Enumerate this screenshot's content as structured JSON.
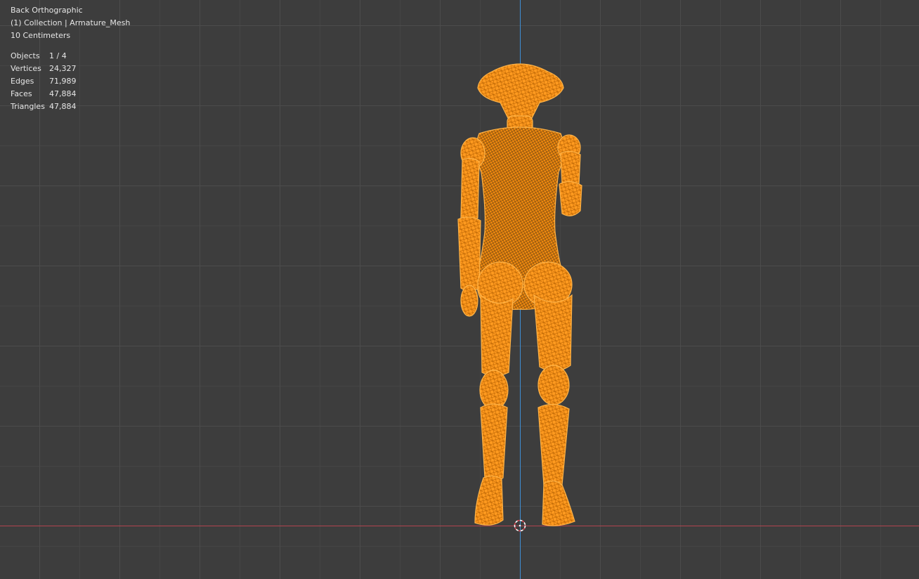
{
  "viewport": {
    "view_name": "Back Orthographic",
    "collection_label": "(1) Collection | Armature_Mesh",
    "scale_label": "10 Centimeters",
    "stats": [
      {
        "label": "Objects",
        "value": "1 / 4"
      },
      {
        "label": "Vertices",
        "value": "24,327"
      },
      {
        "label": "Edges",
        "value": "71,989"
      },
      {
        "label": "Faces",
        "value": "47,884"
      },
      {
        "label": "Triangles",
        "value": "47,884"
      }
    ]
  },
  "colors": {
    "background": "#3d3d3d",
    "grid": "#4c4c4c",
    "selection": "#ff9a1f",
    "axis_x": "#b2434f",
    "axis_z": "#3f8fd4"
  },
  "icons": {
    "cursor": "3d-cursor-icon"
  }
}
